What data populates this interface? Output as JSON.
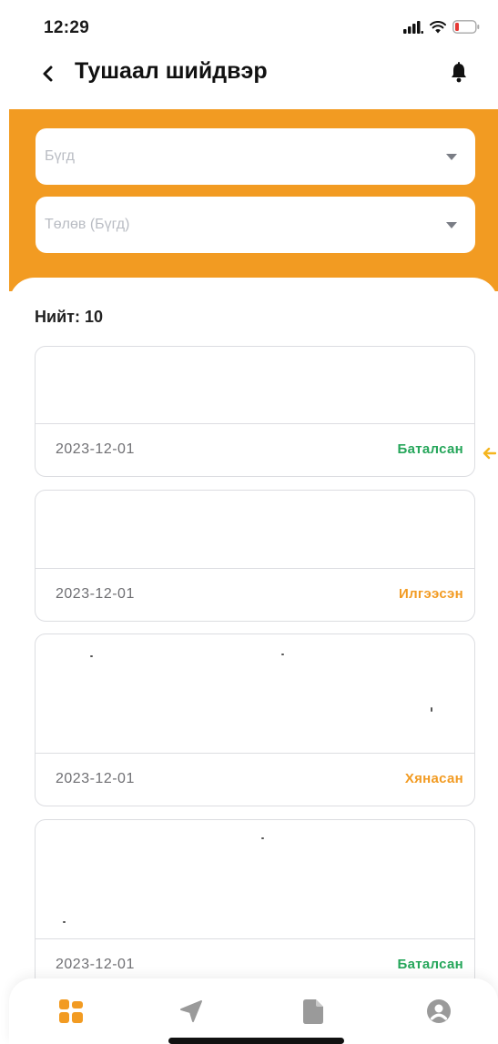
{
  "status_bar": {
    "time": "12:29",
    "icons": [
      "signal-icon",
      "wifi-icon",
      "battery-icon"
    ],
    "battery_color": "#e53935"
  },
  "header": {
    "title": "Тушаал шийдвэр",
    "back_icon": "chevron-left-icon",
    "notification_icon": "bell-icon"
  },
  "filters": {
    "accent_color": "#f29b22",
    "select_1_value": "Бүгд",
    "select_2_value": "Төлөв (Бүгд)"
  },
  "list": {
    "total_label": "Нийт: 10",
    "items": [
      {
        "date": "2023-12-01",
        "status": "Баталсан",
        "status_color": "#25a65a"
      },
      {
        "date": "2023-12-01",
        "status": "Илгээсэн",
        "status_color": "#f29b22"
      },
      {
        "date": "2023-12-01",
        "status": "Хянасан",
        "status_color": "#f29b22"
      },
      {
        "date": "2023-12-01",
        "status": "Баталсан",
        "status_color": "#25a65a"
      }
    ]
  },
  "bottom_nav": {
    "items": [
      {
        "icon": "dashboard-grid-icon",
        "active": true
      },
      {
        "icon": "send-icon",
        "active": false
      },
      {
        "icon": "document-icon",
        "active": false
      },
      {
        "icon": "user-profile-icon",
        "active": false
      }
    ],
    "active_color": "#f29b22",
    "inactive_color": "#9a9a9a"
  }
}
